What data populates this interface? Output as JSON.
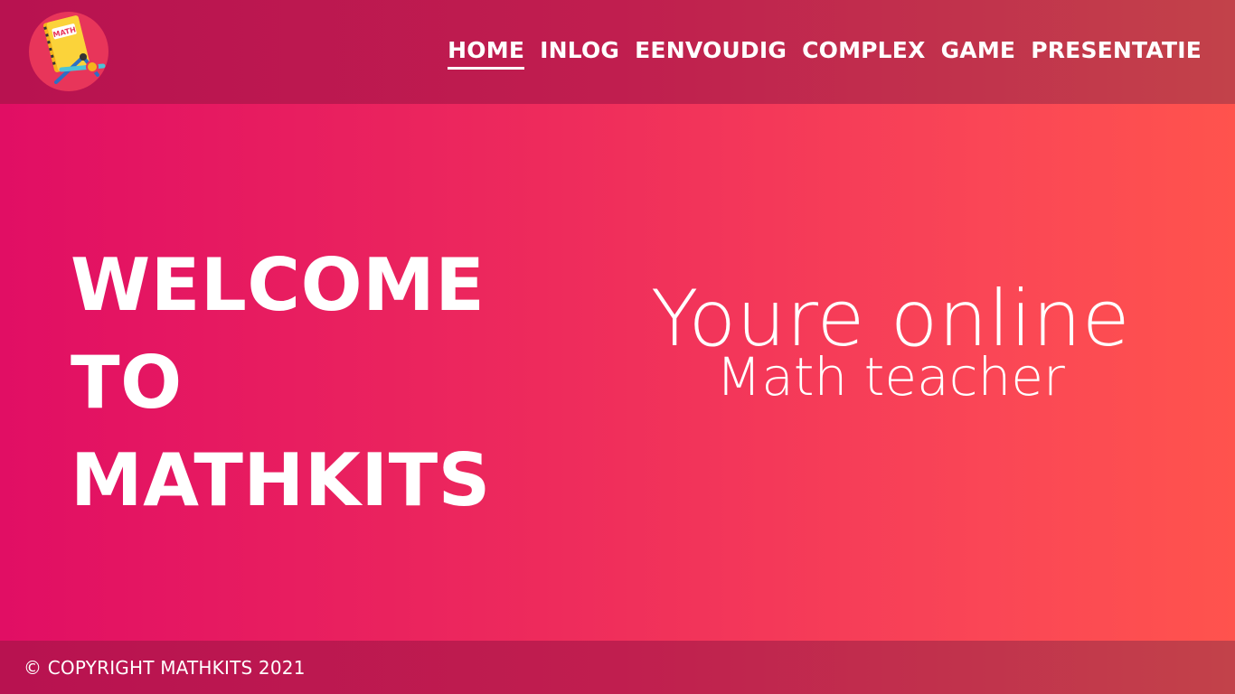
{
  "header": {
    "logo": {
      "icon": "math-notebook-compass-icon",
      "text": "MATH"
    },
    "nav": [
      {
        "label": "HOME",
        "active": true
      },
      {
        "label": "INLOG",
        "active": false
      },
      {
        "label": "EENVOUDIG",
        "active": false
      },
      {
        "label": "COMPLEX",
        "active": false
      },
      {
        "label": "GAME",
        "active": false
      },
      {
        "label": "PRESENTATIE",
        "active": false
      }
    ]
  },
  "hero": {
    "welcome_lines": [
      "WELCOME",
      "TO",
      "MATHKITS"
    ],
    "tagline_main": "Youre online",
    "tagline_sub": "Math teacher"
  },
  "footer": {
    "copyright": "© COPYRIGHT MATHKITS 2021"
  },
  "colors": {
    "header_bar": "#c01e4f",
    "gradient_start": "#e10e64",
    "gradient_end": "#ff534d",
    "text": "#ffffff"
  }
}
